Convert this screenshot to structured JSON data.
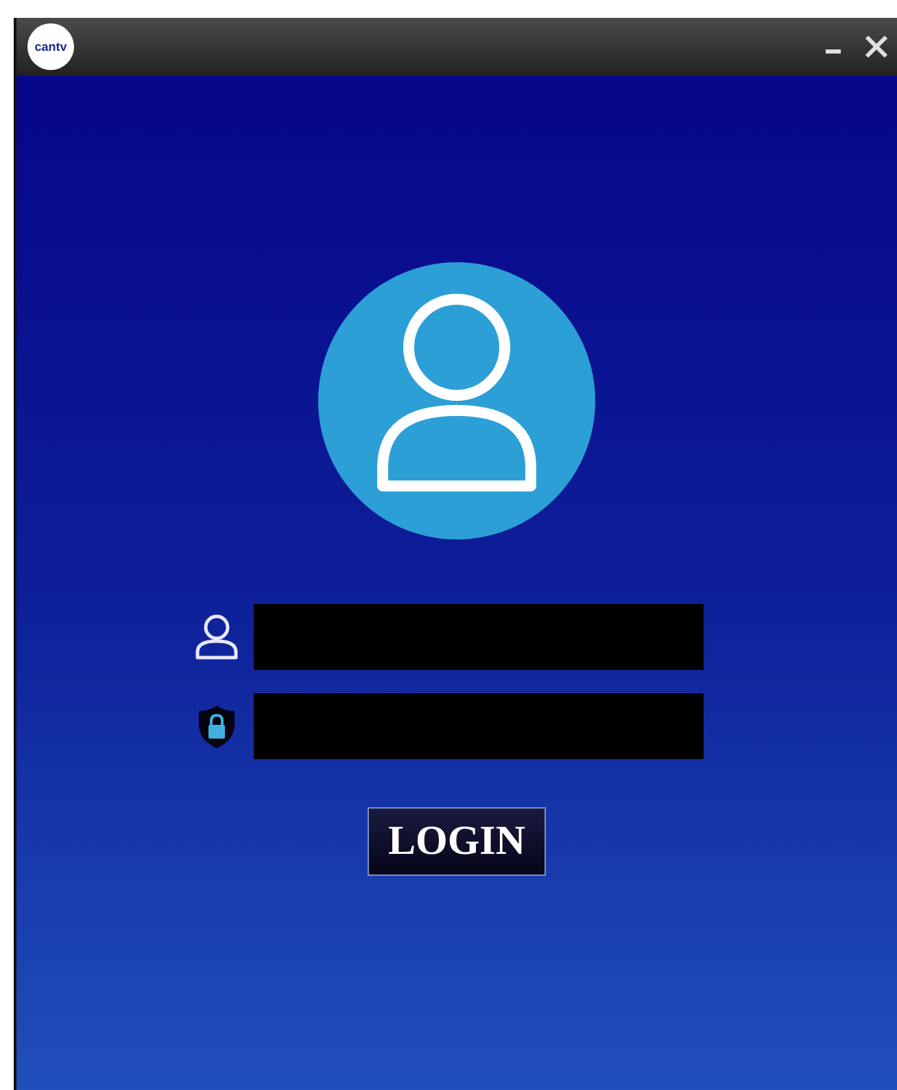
{
  "window": {
    "logo_text": "cantv"
  },
  "fields": [
    {
      "kind": "user"
    },
    {
      "kind": "password"
    }
  ],
  "login_button": "LOGIN"
}
